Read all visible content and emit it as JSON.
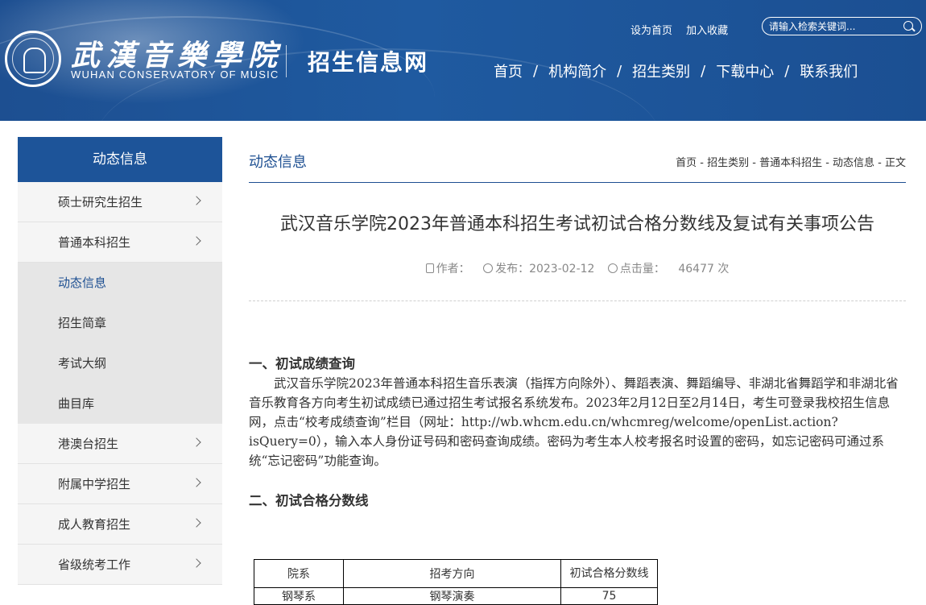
{
  "header": {
    "school_name_cn": "武漢音樂學院",
    "school_name_en": "WUHAN CONSERVATORY OF MUSIC",
    "site_name": "招生信息网",
    "top_links": [
      "设为首页",
      "加入收藏"
    ],
    "search": {
      "placeholder": "请输入检索关键词..."
    },
    "nav": [
      "首页",
      "机构简介",
      "招生类别",
      "下载中心",
      "联系我们"
    ],
    "nav_separator": "/"
  },
  "sidebar": {
    "title": "动态信息",
    "items_top": [
      {
        "label": "硕士研究生招生"
      },
      {
        "label": "普通本科招生"
      }
    ],
    "subitems": [
      {
        "label": "动态信息",
        "active": true
      },
      {
        "label": "招生简章"
      },
      {
        "label": "考试大纲"
      },
      {
        "label": "曲目库"
      }
    ],
    "items_bottom": [
      {
        "label": "港澳台招生"
      },
      {
        "label": "附属中学招生"
      },
      {
        "label": "成人教育招生"
      },
      {
        "label": "省级统考工作"
      }
    ]
  },
  "content": {
    "section_title": "动态信息",
    "breadcrumb": "首页 - 招生类别 - 普通本科招生 - 动态信息 - 正文",
    "article_title": "武汉音乐学院2023年普通本科招生考试初试合格分数线及复试有关事项公告",
    "meta": {
      "author_label": "作者：",
      "publish": "发布：2023-02-12",
      "hits_label": "点击量：",
      "hits": "46477 次"
    },
    "sections": [
      {
        "heading": "一、初试成绩查询",
        "body": "武汉音乐学院2023年普通本科招生音乐表演（指挥方向除外）、舞蹈表演、舞蹈编导、非湖北省舞蹈学和非湖北省音乐教育各方向考生初试成绩已通过招生考试报名系统发布。2023年2月12日至2月14日，考生可登录我校招生信息网，点击“校考成绩查询”栏目（网址：http://wb.whcm.edu.cn/whcmreg/welcome/openList.action?isQuery=0），输入本人身份证号码和密码查询成绩。密码为考生本人校考报名时设置的密码，如忘记密码可通过系统“忘记密码”功能查询。"
      },
      {
        "heading": "二、初试合格分数线"
      }
    ],
    "table": {
      "headers": [
        "院系",
        "招考方向",
        "初试合格分数线"
      ],
      "rows": [
        [
          "钢琴系",
          "钢琴演奏",
          "75"
        ]
      ]
    }
  },
  "colors": {
    "brand_blue": "#1d4f91",
    "sidebar_title_bg": "#1d5499",
    "sidebar_bg": "#f5f5f5",
    "subitem_bg": "#e6e6e6"
  }
}
